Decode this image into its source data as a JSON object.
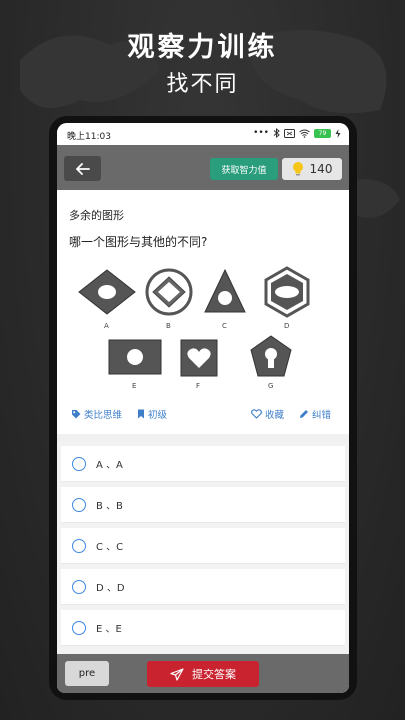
{
  "promo": {
    "title": "观察力训练",
    "subtitle": "找不同"
  },
  "statusbar": {
    "time": "晚上11:03",
    "battery": "79"
  },
  "toolbar": {
    "back_icon": "arrow-left-icon",
    "get_label": "获取智力值",
    "coin_icon": "lightbulb-icon",
    "coin_value": "140"
  },
  "question": {
    "title": "多余的图形",
    "text": "哪一个图形与其他的不同?",
    "figure_labels": [
      "A",
      "B",
      "C",
      "D",
      "E",
      "F",
      "G"
    ]
  },
  "meta": {
    "category": "类比思维",
    "level": "初级",
    "favorite": "收藏",
    "report": "纠错"
  },
  "options": [
    {
      "label": "A 、A"
    },
    {
      "label": "B 、B"
    },
    {
      "label": "C 、C"
    },
    {
      "label": "D 、D"
    },
    {
      "label": "E 、E"
    }
  ],
  "bottom": {
    "pre_label": "pre",
    "submit_label": "提交答案"
  },
  "colors": {
    "toolbar": "#6a6a6a",
    "accent_green": "#2a9d7d",
    "submit_red": "#c9232f",
    "link_blue": "#3f7fc9"
  }
}
